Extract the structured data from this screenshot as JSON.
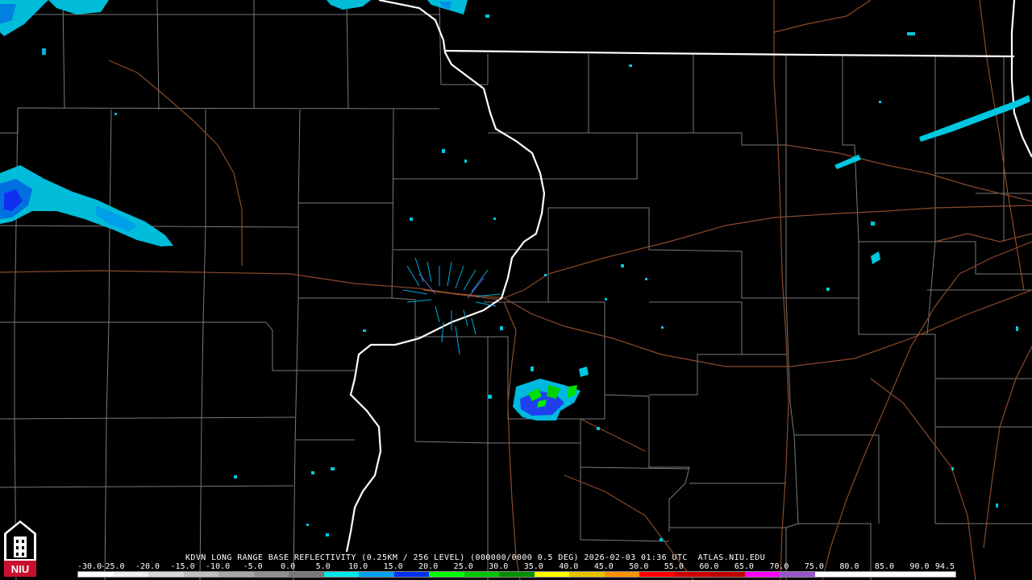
{
  "caption": "KDVN LONG RANGE BASE REFLECTIVITY (0.25KM / 256 LEVEL) (000000/0000 0.5 DEG) 2026-02-03 01:36 UTC  ATLAS.NIU.EDU",
  "scale": {
    "labels": [
      "-30.0",
      "-25.0",
      "-20.0",
      "-15.0",
      "-10.0",
      "-5.0",
      "0.0",
      "5.0",
      "10.0",
      "15.0",
      "20.0",
      "25.0",
      "30.0",
      "35.0",
      "40.0",
      "45.0",
      "50.0",
      "55.0",
      "60.0",
      "65.0",
      "70.0",
      "75.0",
      "80.0",
      "85.0",
      "90.0",
      "94.5"
    ],
    "colors": [
      "#ffffff",
      "#f0f0f0",
      "#d8d8d8",
      "#c0c0c0",
      "#a8a8a8",
      "#909090",
      "#787878",
      "#00e8e8",
      "#00a0f0",
      "#0030f0",
      "#00ff00",
      "#00c800",
      "#009000",
      "#ffff00",
      "#e8c000",
      "#ff9000",
      "#ff0000",
      "#d00000",
      "#c00000",
      "#ff00ff",
      "#9955cc",
      "#ffffff",
      "#ffffff",
      "#ffffff",
      "#ffffff"
    ]
  },
  "logo": {
    "text": "NIU",
    "accent": "#c8102e"
  }
}
